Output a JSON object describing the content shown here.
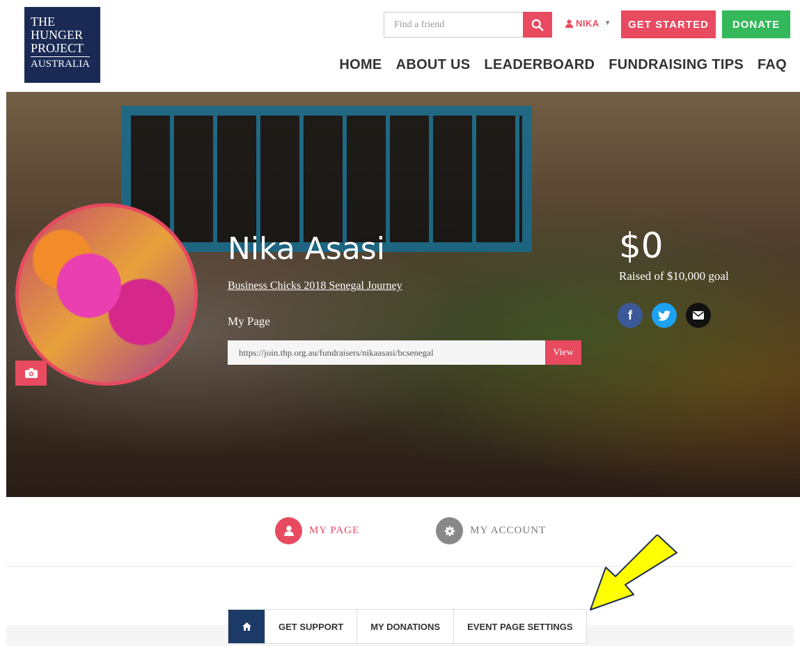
{
  "logo": {
    "line1": "THE",
    "line2": "HUNGER",
    "line3": "PROJECT",
    "line4": "AUSTRALIA"
  },
  "header": {
    "search_placeholder": "Find a friend",
    "user_name": "NIKA",
    "get_started_label": "GET STARTED",
    "donate_label": "DONATE",
    "nav": [
      "HOME",
      "ABOUT US",
      "LEADERBOARD",
      "FUNDRAISING TIPS",
      "FAQ"
    ]
  },
  "hero": {
    "name": "Nika Asasi",
    "event_link": "Business Chicks 2018 Senegal Journey",
    "my_page_label": "My Page",
    "page_url": "https://join.thp.org.au/fundraisers/nikaasasi/bcsenegal",
    "view_label": "View",
    "amount": "$0",
    "goal_text": "Raised of $10,000 goal"
  },
  "profile_tabs": {
    "my_page": "MY PAGE",
    "my_account": "MY ACCOUNT"
  },
  "subnav": {
    "get_support": "GET SUPPORT",
    "my_donations": "MY DONATIONS",
    "event_page_settings": "EVENT PAGE SETTINGS"
  },
  "colors": {
    "brand_navy": "#1b2a55",
    "accent_red": "#e84a5f",
    "donate_green": "#35b85b",
    "arrow_yellow": "#ffff00"
  }
}
